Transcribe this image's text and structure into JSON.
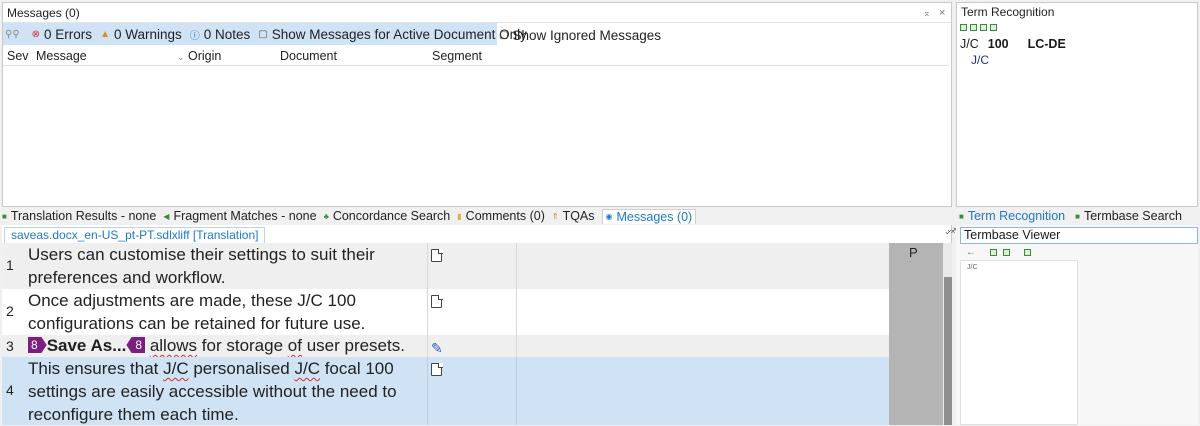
{
  "messages_panel": {
    "title": "Messages (0)",
    "pin": "⌅",
    "close": "×",
    "toolbar": {
      "errors": "0 Errors",
      "warnings": "0 Warnings",
      "notes": "0 Notes",
      "active_doc_only": "Show Messages for Active Document Only",
      "show_ignored": "Show Ignored Messages"
    },
    "columns": [
      "Sev",
      "Message",
      "Origin",
      "Document",
      "Segment"
    ]
  },
  "term_panel": {
    "title": "Term Recognition",
    "term": "J/C",
    "score": "100",
    "code": "LC-DE",
    "sub": "J/C"
  },
  "bottom_tabs": [
    "Translation Results - none",
    "Fragment Matches - none",
    "Concordance Search",
    "Comments (0)",
    "TQAs",
    "Messages (0)"
  ],
  "right_tabs": [
    "Term Recognition",
    "Termbase Search"
  ],
  "editor": {
    "doc_tab": "saveas.docx_en-US_pt-PT.sdlxliff [Translation]",
    "status_letter": "P",
    "segments": [
      {
        "num": "1",
        "text": "Users can customise their settings to suit their preferences and workflow."
      },
      {
        "num": "2",
        "text": "Once adjustments are made, these J/C 100 configurations can be retained for future use."
      },
      {
        "num": "3",
        "tag_open": "8",
        "bold": "Save As...",
        "tag_close": "8",
        "w1": "allows",
        "mid": " for storage ",
        "w2": "of",
        "end": " user presets."
      },
      {
        "num": "4",
        "p1": "This ensures that ",
        "jc1": "J/C",
        "p2": " personalised ",
        "jc2": "J/C",
        "p3": " focal 100 settings are easily accessible without the need to reconfigure them each time."
      }
    ]
  },
  "termbase_viewer": {
    "title": "Termbase Viewer",
    "inner_label": "J/C"
  },
  "colors": {
    "accent": "#1e78c8",
    "selection": "#cfe3f5",
    "tag": "#7b1e7f",
    "spell": "#d0302a"
  }
}
